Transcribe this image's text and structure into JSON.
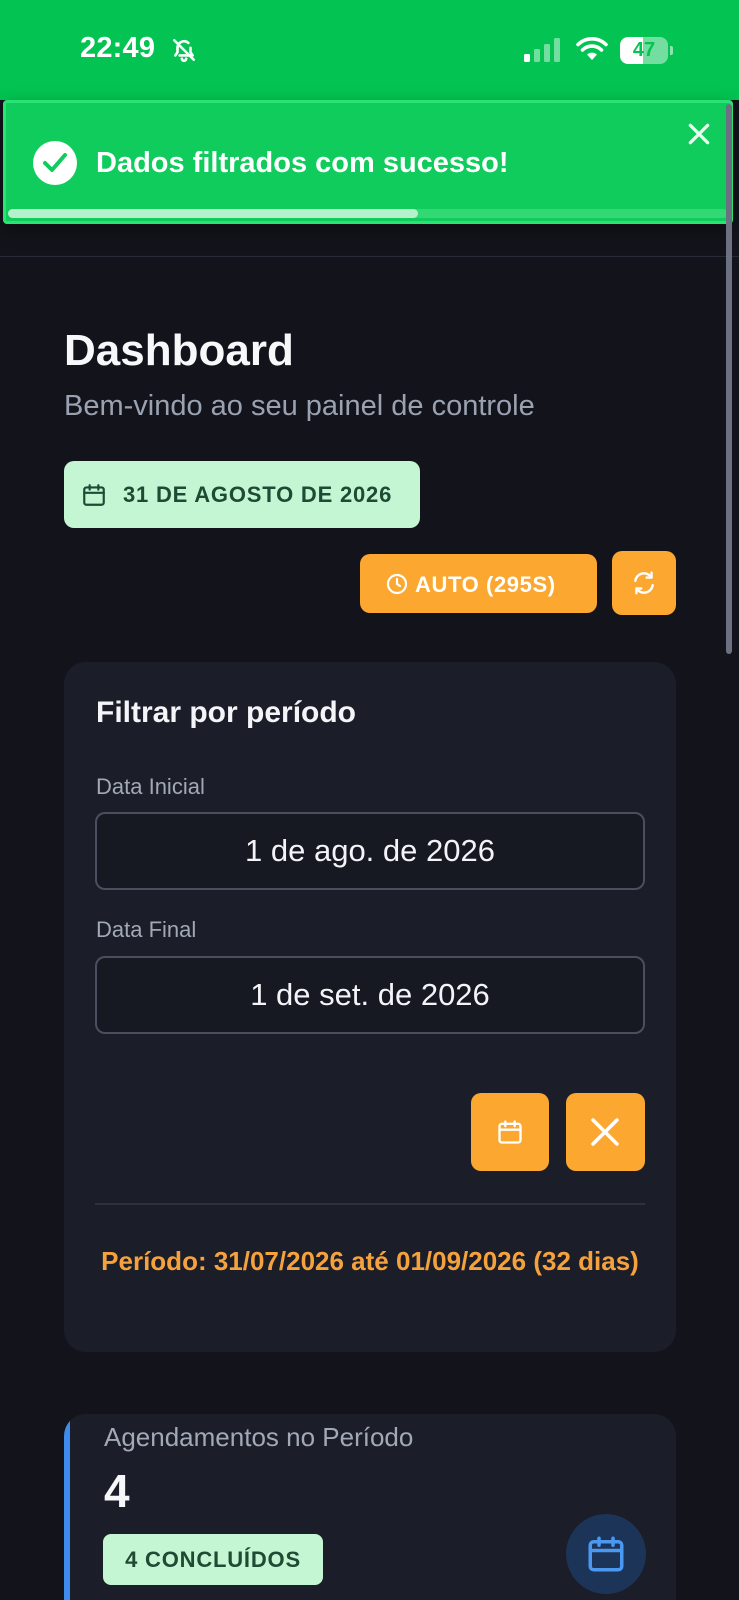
{
  "status_bar": {
    "time": "22:49",
    "battery_level": "47",
    "battery_fraction": 0.47,
    "icons": [
      "bell-slash-icon",
      "cellular-signal-icon",
      "wifi-icon",
      "battery-icon"
    ]
  },
  "toast": {
    "message": "Dados filtrados com sucesso!",
    "progress": 0.57,
    "icons": [
      "check-circle-icon",
      "close-icon"
    ]
  },
  "header": {
    "title": "Dashboard",
    "subtitle": "Bem-vindo ao seu painel de controle",
    "date_badge": "31 DE AGOSTO DE 2026",
    "auto_refresh_label": "AUTO (295S)",
    "icons": [
      "calendar-icon",
      "clock-icon",
      "refresh-icon"
    ]
  },
  "filter": {
    "title": "Filtrar por período",
    "start_label": "Data Inicial",
    "start_value": "1 de ago. de 2026",
    "end_label": "Data Final",
    "end_value": "1 de set. de 2026",
    "period_text": "Período: 31/07/2026 até 01/09/2026 (32 dias)",
    "icons": [
      "calendar-icon",
      "close-icon"
    ]
  },
  "stats": {
    "appointments": {
      "label": "Agendamentos no Período",
      "value": "4",
      "badge": "4 CONCLUÍDOS",
      "icon": "calendar-icon"
    }
  },
  "colors": {
    "status_bar": "#03c452",
    "toast": "#0fcc5c",
    "background": "#13141b",
    "card": "#1b1d28",
    "accent_orange": "#fba730",
    "badge_green": "#c5f6d4",
    "stat_accent_blue": "#3d8bea"
  }
}
